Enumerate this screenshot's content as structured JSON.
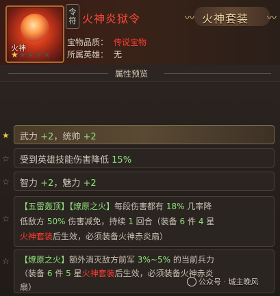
{
  "header": {
    "item_thumb_label": "火神",
    "stars": {
      "filled": 1,
      "total": 5
    },
    "tag": [
      "令",
      "符"
    ],
    "title": "火神炎狱令",
    "quality_label": "宝物品质：",
    "quality_value": "传说宝物",
    "hero_label": "所属英雄：",
    "hero_value": "无",
    "set_label": "火神套装"
  },
  "panel": {
    "title": "属性预览",
    "rows": [
      {
        "star": "on",
        "line": {
          "a": "武力",
          "b": "+2",
          "c": "，统帅",
          "d": "+2"
        }
      },
      {
        "star": "off",
        "line": {
          "a": "受到英雄技能伤害降低",
          "b": "15%"
        }
      },
      {
        "star": "off",
        "line": {
          "a": "智力",
          "b": "+2",
          "c": "，魅力",
          "d": "+2"
        }
      },
      {
        "star": "off",
        "l1": {
          "a": "【五雷轰顶】",
          "b": "【燎原之火】",
          "c": "每段伤害都有",
          "d": "18%",
          "e": "几率降"
        },
        "l2": {
          "a": "低敌方",
          "b": "50%",
          "c": "伤害减免，持续",
          "d": "1",
          "e": "回合（装备",
          "f": "6",
          "g": "件",
          "h": "4",
          "i": "星"
        },
        "l3": {
          "a": "火神套装",
          "b": "后生效，必须装备火神赤炎扇）"
        }
      },
      {
        "star": "off",
        "l1": {
          "a": "【燎原之火】",
          "b": "额外消灭敌方前军",
          "c": "3%~5%",
          "d": "的当前兵力"
        },
        "l2": {
          "a": "（装备",
          "b": "6",
          "c": "件",
          "d": "5",
          "e": "星",
          "f": "火神套装",
          "g": "后生效，必须装备火神赤炎"
        },
        "l3": {
          "a": "扇）"
        }
      }
    ]
  },
  "watermark": "公众号 · 城主晚风",
  "colors": {
    "highlight_green": "#8fe07a",
    "highlight_red": "#ff3b2f",
    "star_gold": "#f2c94c"
  }
}
